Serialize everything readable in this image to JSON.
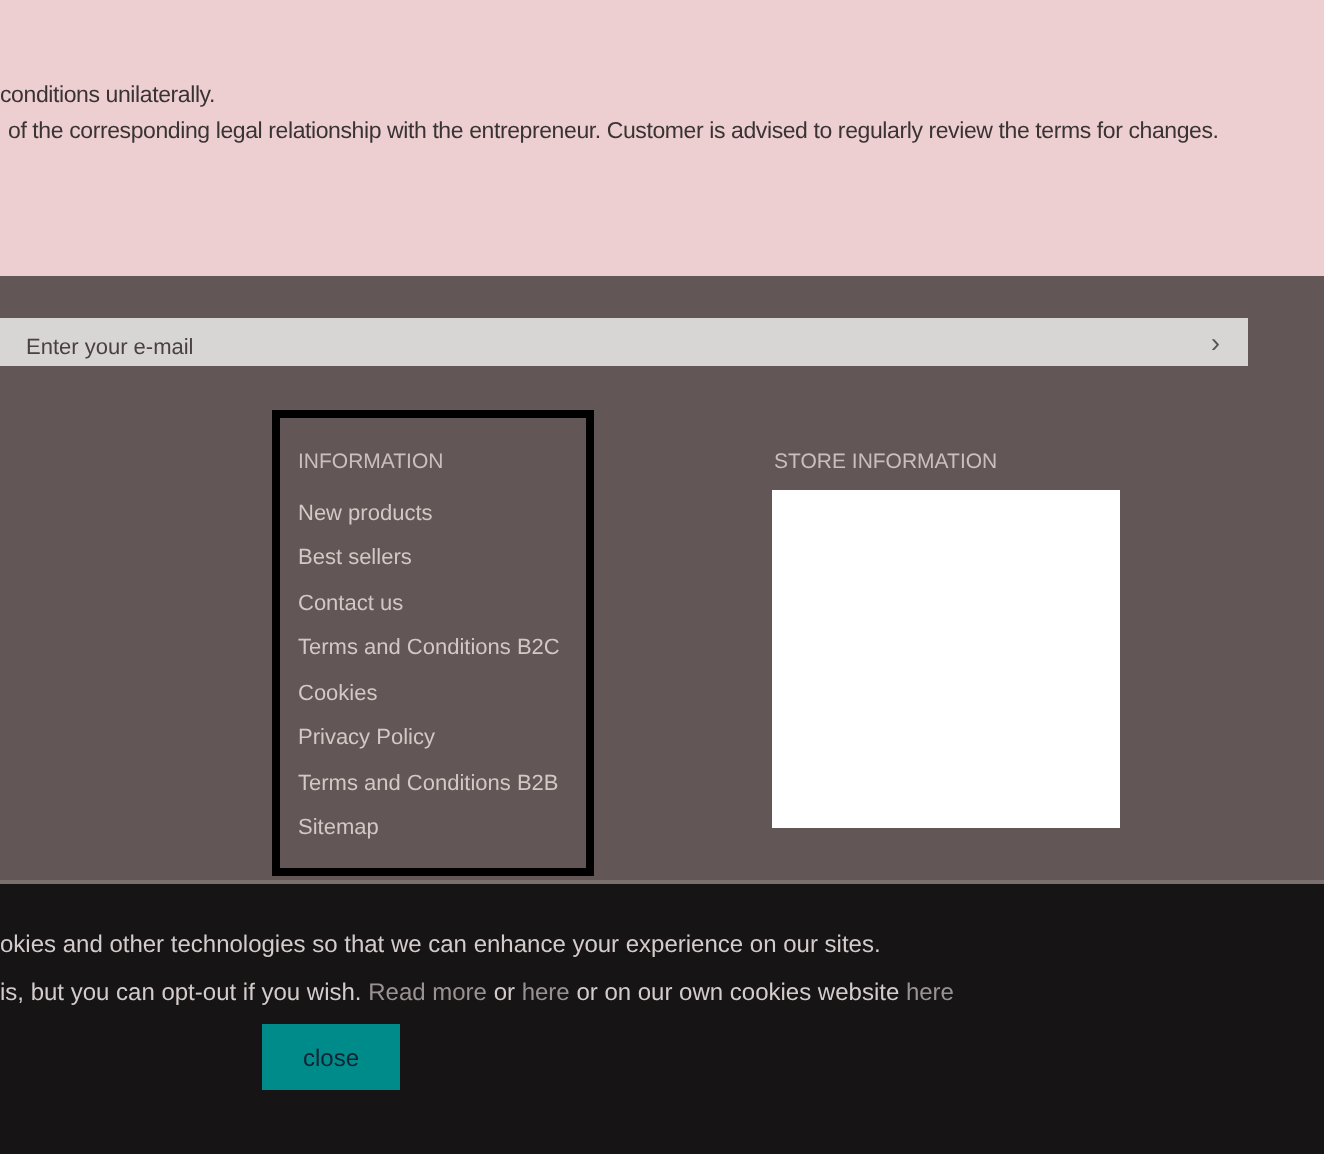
{
  "terms_notice": {
    "lines": [
      "conditions unilaterally.",
      "of the corresponding legal relationship with the entrepreneur. Customer is advised to regularly review the terms for changes."
    ]
  },
  "newsletter": {
    "placeholder": "Enter your e-mail",
    "submit": "›"
  },
  "information": {
    "heading": "INFORMATION",
    "links": [
      "New products",
      "Best sellers",
      "Contact us",
      "Terms and Conditions B2C",
      "Cookies",
      "Privacy Policy",
      "Terms and Conditions B2B",
      "Sitemap"
    ]
  },
  "store_information": {
    "heading": "STORE INFORMATION"
  },
  "cookie_banner": {
    "line_1": "okies and other technologies so that we can enhance your experience on our sites.",
    "line_2": [
      {
        "kind": "text",
        "text": "is, but you can opt-out if you wish. "
      },
      {
        "kind": "link",
        "text": "Read more"
      },
      {
        "kind": "text",
        "text": " or "
      },
      {
        "kind": "link",
        "text": "here"
      },
      {
        "kind": "text",
        "text": " or on our own cookies website "
      },
      {
        "kind": "link",
        "text": "here"
      }
    ],
    "button": "close"
  }
}
